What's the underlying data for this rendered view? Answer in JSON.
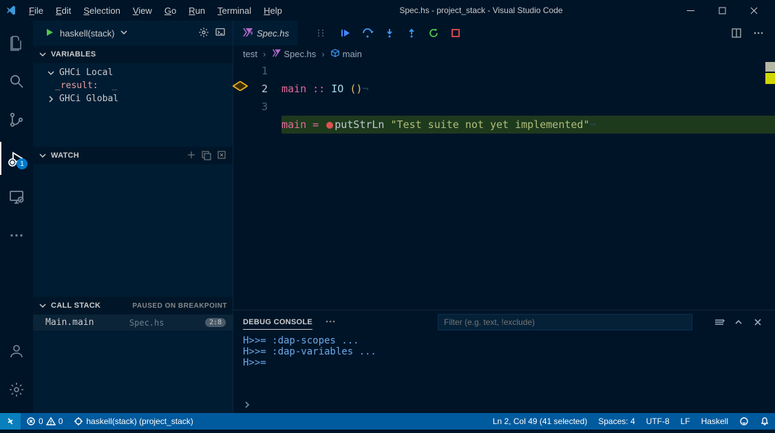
{
  "title": "Spec.hs - project_stack - Visual Studio Code",
  "menu": [
    "File",
    "Edit",
    "Selection",
    "View",
    "Go",
    "Run",
    "Terminal",
    "Help"
  ],
  "debugConfig": {
    "name": "haskell(stack)"
  },
  "sidebar": {
    "variables": {
      "title": "VARIABLES",
      "scopes": [
        {
          "name": "GHCi Local",
          "items": [
            {
              "name": "_result:",
              "trail": "_"
            }
          ]
        },
        {
          "name": "GHCi Global"
        }
      ]
    },
    "watch": {
      "title": "WATCH"
    },
    "callstack": {
      "title": "CALL STACK",
      "status": "PAUSED ON BREAKPOINT",
      "frames": [
        {
          "fn": "Main.main",
          "file": "Spec.hs",
          "badge": "2:8"
        }
      ]
    }
  },
  "tab": {
    "label": "Spec.hs"
  },
  "breadcrumbs": {
    "folder": "test",
    "file": "Spec.hs",
    "symbol": "main"
  },
  "editor": {
    "lines": [
      "1",
      "2",
      "3"
    ],
    "l1": {
      "main": "main",
      "dcolon": " :: ",
      "io": "IO ",
      "lp": "(",
      "rp": ")"
    },
    "l2": {
      "main": "main",
      "eq": " = ",
      "fn": "putStrLn ",
      "str": "\"Test suite not yet implemented\""
    }
  },
  "panel": {
    "tab": "Debug Console",
    "filterPlaceholder": "Filter (e.g. text, !exclude)",
    "lines": [
      "H>>= :dap-scopes ...",
      "H>>= :dap-variables ...",
      "H>>="
    ]
  },
  "status": {
    "errors": "0",
    "warnings": "0",
    "debug": "haskell(stack) (project_stack)",
    "cursor": "Ln 2, Col 49 (41 selected)",
    "spaces": "Spaces: 4",
    "encoding": "UTF-8",
    "eol": "LF",
    "lang": "Haskell"
  },
  "activityBadge": "1"
}
